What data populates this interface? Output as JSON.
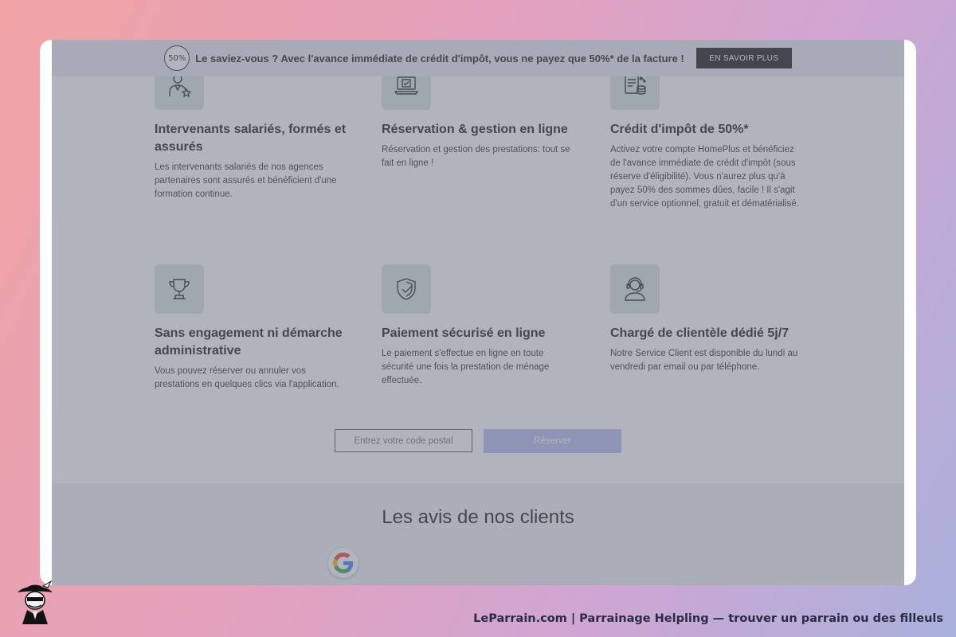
{
  "banner": {
    "badge": "50%",
    "text": "Le saviez-vous ? Avec l'avance immédiate de crédit d'impôt, vous ne payez que 50%* de la facture !",
    "button": "EN SAVOIR PLUS"
  },
  "features": [
    {
      "icon": "worker-star-icon",
      "title": "Intervenants salariés, formés et assurés",
      "desc": "Les intervenants salariés de nos agences partenaires sont assurés et bénéficient d'une formation continue."
    },
    {
      "icon": "laptop-check-icon",
      "title": "Réservation & gestion en ligne",
      "desc": "Réservation et gestion des prestations: tout se fait en ligne !"
    },
    {
      "icon": "tax-coins-icon",
      "title": "Crédit d'impôt de 50%*",
      "desc": "Activez votre compte HomePlus et bénéficiez de l'avance immédiate de crédit d'impôt (sous réserve d'éligibilité). Vous n'aurez plus qu'à payez 50% des sommes dûes, facile ! Il s'agit d'un service optionnel, gratuit et dématérialisé."
    },
    {
      "icon": "trophy-icon",
      "title": "Sans engagement ni démarche administrative",
      "desc": "Vous pouvez réserver ou annuler vos prestations en quelques clics via l'application."
    },
    {
      "icon": "shield-check-icon",
      "title": "Paiement sécurisé en ligne",
      "desc": "Le paiement s'effectue en ligne en toute sécurité une fois la prestation de ménage effectuée."
    },
    {
      "icon": "headset-agent-icon",
      "title": "Chargé de clientèle dédié 5j/7",
      "desc": "Notre Service Client est disponible du lundi au vendredi par email ou par téléphone."
    }
  ],
  "booking": {
    "postal_placeholder": "Entrez votre code postal",
    "reserve_label": "Réserver"
  },
  "reviews": {
    "title": "Les avis de nos clients",
    "source_icon": "google-icon"
  },
  "footer": {
    "text": "LeParrain.com | Parrainage Helpling — trouver un parrain ou des filleuls"
  },
  "colors": {
    "icon_tile": "#d8e6e2",
    "reserve_button": "#b5bdf0",
    "banner_button": "#1a1a1a"
  }
}
